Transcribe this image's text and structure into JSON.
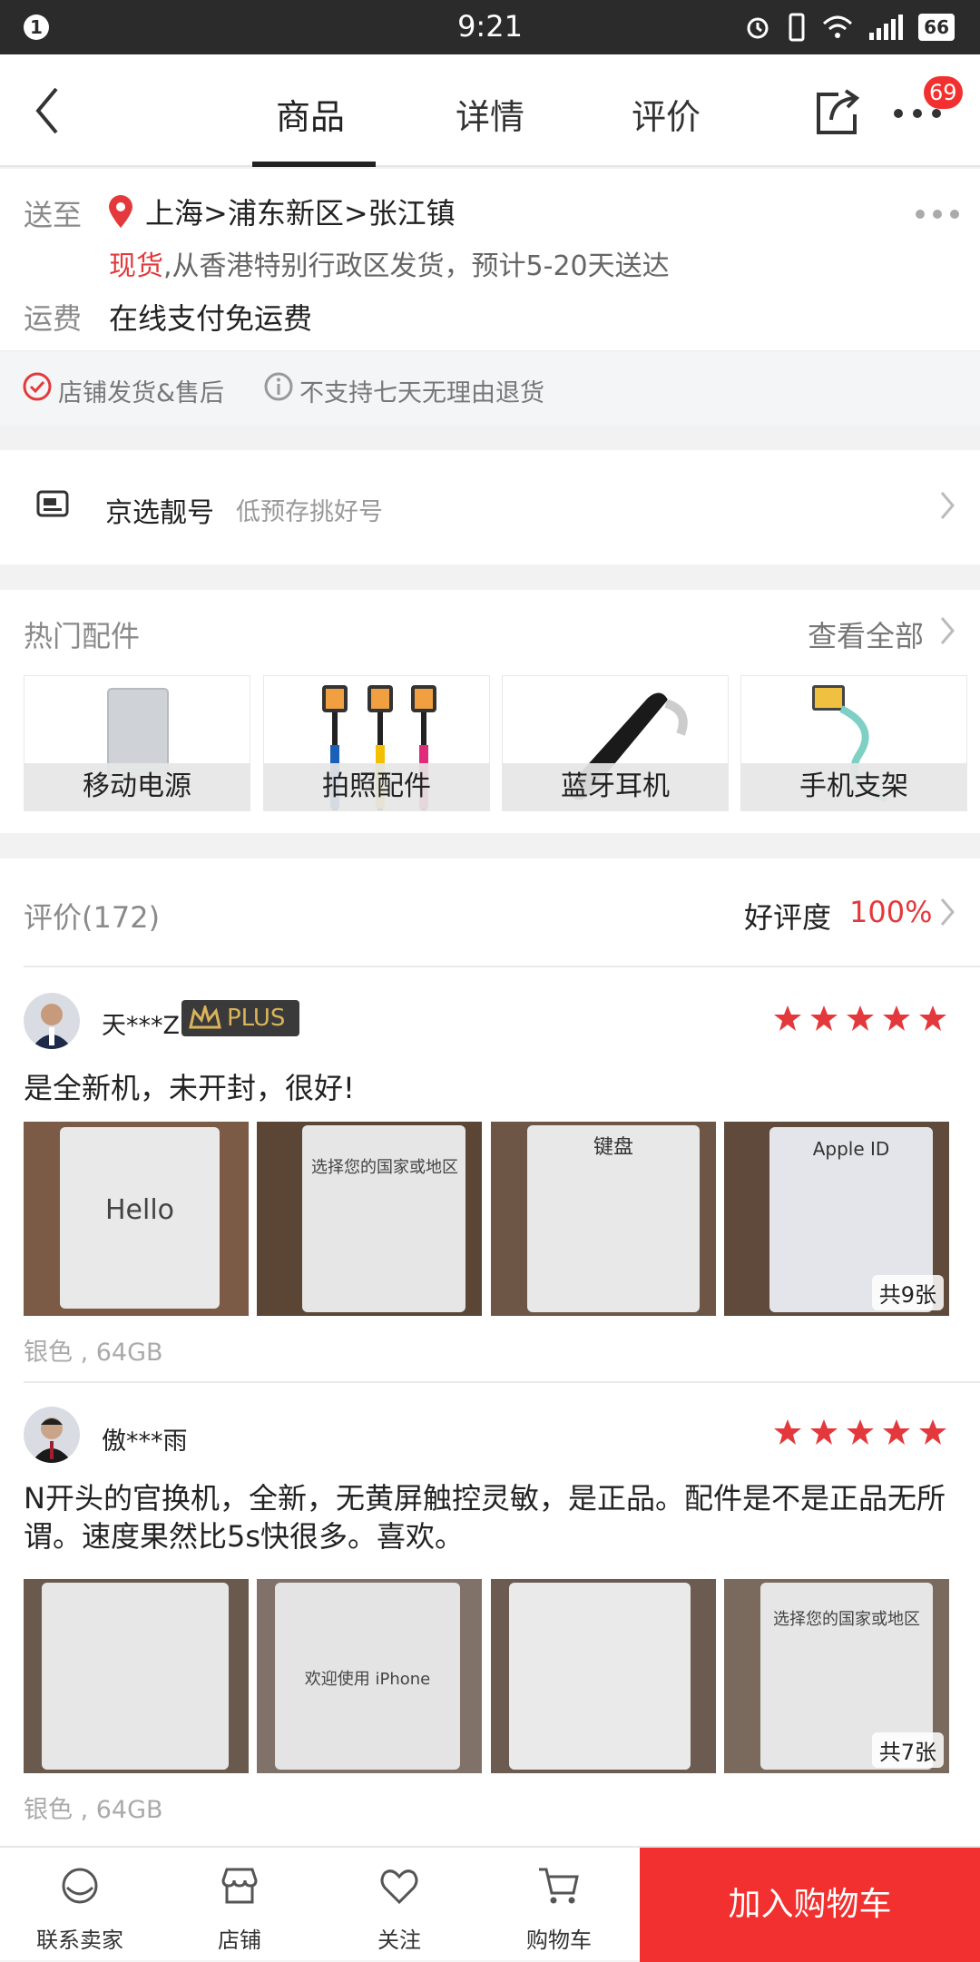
{
  "status": {
    "time": "9:21",
    "notification": "1",
    "battery": "66"
  },
  "nav": {
    "tabs": [
      "商品",
      "详情",
      "评价"
    ],
    "active": "商品",
    "badge": "69"
  },
  "delivery": {
    "ship_to_label": "送至",
    "address": "上海>浦东新区>张江镇",
    "stock_status": "现货",
    "ship_info": ",从香港特别行政区发货，预计5-20天送达",
    "fee_label": "运费",
    "fee_value": "在线支付免运费"
  },
  "service": {
    "shop_service": "店铺发货&售后",
    "no_return": "不支持七天无理由退货"
  },
  "number_select": {
    "title": "京选靓号",
    "subtitle": "低预存挑好号"
  },
  "accessories": {
    "title": "热门配件",
    "view_all": "查看全部",
    "items": [
      "移动电源",
      "拍照配件",
      "蓝牙耳机",
      "手机支架"
    ]
  },
  "reviews": {
    "title": "评价(172)",
    "rating_label": "好评度",
    "rating_value": "100%",
    "list": [
      {
        "user": "天***Z",
        "plus": "PLUS",
        "text": "是全新机，未开封，很好!",
        "spec": "银色 , 64GB",
        "photo_count": "共9张",
        "photo_texts": [
          "Hello",
          "选择您的国家或地区",
          "键盘",
          "Apple ID"
        ]
      },
      {
        "user": "傲***雨",
        "text": "N开头的官换机，全新，无黄屏触控灵敏，是正品。配件是不是正品无所谓。速度果然比5s快很多。喜欢。",
        "spec": "银色 , 64GB",
        "photo_count": "共7张",
        "photo_texts": [
          "",
          "欢迎使用 iPhone",
          "",
          "选择您的国家或地区"
        ]
      }
    ]
  },
  "bottom_bar": {
    "contact": "联系卖家",
    "shop": "店铺",
    "follow": "关注",
    "cart": "购物车",
    "add_to_cart": "加入购物车"
  },
  "colors": {
    "accent": "#f23030",
    "star": "#e4393c"
  }
}
